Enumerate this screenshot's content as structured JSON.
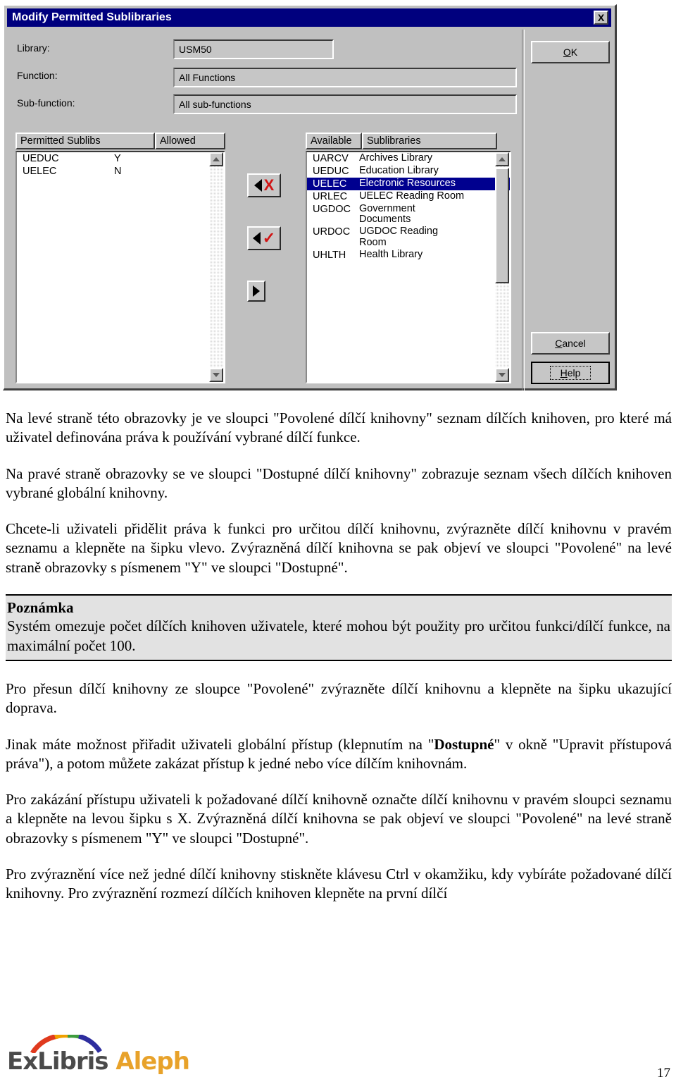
{
  "dialog": {
    "title": "Modify Permitted Sublibraries",
    "close_label": "X",
    "fields": [
      {
        "label": "Library:",
        "value": "USM50"
      },
      {
        "label": "Function:",
        "value": "All Functions"
      },
      {
        "label": "Sub-function:",
        "value": "All sub-functions"
      }
    ],
    "left_list": {
      "header_code": "Permitted Sublibs",
      "header_allowed": "Allowed",
      "rows": [
        {
          "code": "UEDUC",
          "allowed": "Y"
        },
        {
          "code": "UELEC",
          "allowed": "N"
        }
      ]
    },
    "right_list": {
      "header_available": "Available",
      "header_sublibraries": "Sublibraries",
      "rows": [
        {
          "code": "UARCV",
          "name": "Archives Library",
          "selected": false
        },
        {
          "code": "UEDUC",
          "name": "Education Library",
          "selected": false
        },
        {
          "code": "UELEC",
          "name": "Electronic Resources",
          "selected": true
        },
        {
          "code": "URLEC",
          "name": "UELEC Reading Room",
          "selected": false
        },
        {
          "code": "UGDOC",
          "name": "Government Documents",
          "selected": false
        },
        {
          "code": "URDOC",
          "name": "UGDOC Reading Room",
          "selected": false
        },
        {
          "code": "UHLTH",
          "name": "Health Library",
          "selected": false
        }
      ]
    },
    "mid_buttons": [
      {
        "name": "remove-deny",
        "mark": "X"
      },
      {
        "name": "add-allow",
        "mark": "✓"
      },
      {
        "name": "move-right",
        "mark": ""
      }
    ],
    "actions": {
      "ok": "OK",
      "cancel": "Cancel",
      "help": "Help"
    },
    "colors": {
      "titlebar": "#00007e",
      "selection": "#00008f",
      "face": "#c0c0c0",
      "mark_red": "#d11414"
    }
  },
  "document": {
    "paragraphs": [
      "Na levé straně této obrazovky je ve sloupci \"Povolené dílčí knihovny\" seznam dílčích knihoven, pro které má uživatel definována práva k používání vybrané dílčí funkce.",
      "Na pravé straně obrazovky se ve sloupci \"Dostupné dílčí knihovny\" zobrazuje seznam všech dílčích knihoven vybrané globální knihovny.",
      "Chcete-li uživateli přidělit práva k funkci pro určitou dílčí knihovnu, zvýrazněte dílčí knihovnu v pravém seznamu a klepněte na šipku vlevo. Zvýrazněná dílčí knihovna se pak objeví ve sloupci \"Povolené\" na levé straně obrazovky s písmenem \"Y\" ve sloupci \"Dostupné\"."
    ],
    "note": {
      "title": "Poznámka",
      "body": "Systém omezuje počet dílčích knihoven uživatele, které mohou být použity pro určitou funkci/dílčí funkce, na maximální počet 100."
    },
    "paragraphs_after": [
      "Pro přesun dílčí knihovny ze sloupce \"Povolené\" zvýrazněte dílčí knihovnu a klepněte na šipku ukazující doprava."
    ],
    "para_bold": {
      "before": "Jinak máte možnost přiřadit uživateli globální přístup (klepnutím na \"",
      "bold": "Dostupné",
      "after": "\" v okně \"Upravit přístupová práva\"), a potom můžete zakázat přístup k jedné nebo více dílčím knihovnám."
    },
    "paragraphs_tail": [
      "Pro zakázání přístupu uživateli k požadované dílčí knihovně označte dílčí knihovnu v pravém sloupci seznamu a klepněte na levou šipku s X. Zvýrazněná dílčí knihovna se pak objeví ve sloupci \"Povolené\" na levé straně obrazovky s písmenem \"Y\" ve sloupci \"Dostupné\".",
      "Pro zvýraznění více než jedné dílčí knihovny stiskněte klávesu Ctrl v okamžiku, kdy vybíráte požadované dílčí knihovny. Pro zvýraznění rozmezí dílčích knihoven klepněte na první dílčí"
    ]
  },
  "footer": {
    "logo_ex": "ExLibris",
    "logo_aleph": "Aleph",
    "page_number": "17"
  }
}
